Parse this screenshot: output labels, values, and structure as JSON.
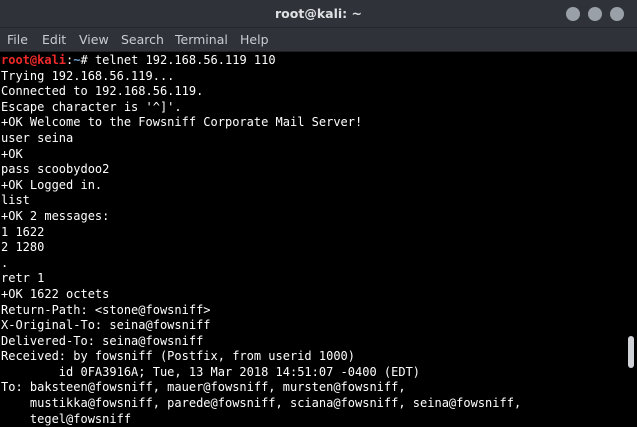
{
  "window": {
    "title": "root@kali: ~"
  },
  "menu": [
    {
      "label": "File"
    },
    {
      "label": "Edit"
    },
    {
      "label": "View"
    },
    {
      "label": "Search"
    },
    {
      "label": "Terminal"
    },
    {
      "label": "Help"
    }
  ],
  "prompt": {
    "user_host": "root@kali",
    "separator": ":",
    "path": "~",
    "symbol": "# ",
    "command": "telnet 192.168.56.119 110"
  },
  "output": [
    "Trying 192.168.56.119...",
    "Connected to 192.168.56.119.",
    "Escape character is '^]'.",
    "+OK Welcome to the Fowsniff Corporate Mail Server!",
    "user seina",
    "+OK",
    "pass scoobydoo2",
    "+OK Logged in.",
    "list",
    "+OK 2 messages:",
    "1 1622",
    "2 1280",
    ".",
    "retr 1",
    "+OK 1622 octets",
    "Return-Path: <stone@fowsniff>",
    "X-Original-To: seina@fowsniff",
    "Delivered-To: seina@fowsniff",
    "Received: by fowsniff (Postfix, from userid 1000)",
    "        id 0FA3916A; Tue, 13 Mar 2018 14:51:07 -0400 (EDT)",
    "To: baksteen@fowsniff, mauer@fowsniff, mursten@fowsniff,",
    "    mustikka@fowsniff, parede@fowsniff, sciana@fowsniff, seina@fowsniff,",
    "    tegel@fowsniff"
  ]
}
